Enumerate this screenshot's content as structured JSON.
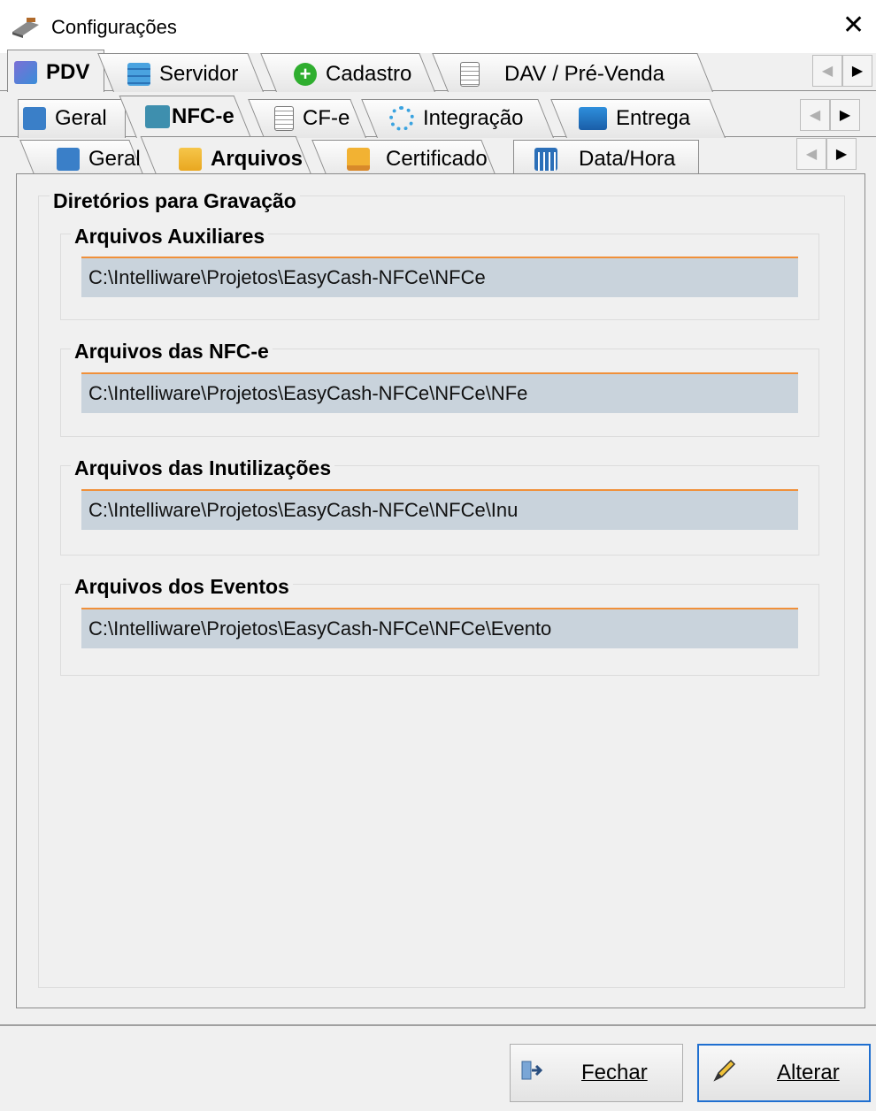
{
  "window": {
    "title": "Configurações"
  },
  "tabs_level1": [
    {
      "label": "PDV",
      "icon": "pdv-icon",
      "active": true
    },
    {
      "label": "Servidor",
      "icon": "server-icon"
    },
    {
      "label": "Cadastro",
      "icon": "add-icon"
    },
    {
      "label": "DAV / Pré-Venda",
      "icon": "document-icon"
    }
  ],
  "tabs_level2": [
    {
      "label": "Geral",
      "icon": "grid-icon"
    },
    {
      "label": "NFC-e",
      "icon": "nfce-icon",
      "active": true
    },
    {
      "label": "CF-e",
      "icon": "document-icon"
    },
    {
      "label": "Integração",
      "icon": "sync-icon"
    },
    {
      "label": "Entrega",
      "icon": "truck-icon"
    }
  ],
  "tabs_level3": [
    {
      "label": "Geral",
      "icon": "grid-icon"
    },
    {
      "label": "Arquivos",
      "icon": "folder-icon",
      "active": true
    },
    {
      "label": "Certificado",
      "icon": "certificate-icon"
    },
    {
      "label": "Data/Hora",
      "icon": "calendar-icon"
    }
  ],
  "main": {
    "section_title": "Diretórios para Gravação",
    "groups": [
      {
        "label": "Arquivos Auxiliares",
        "value": "C:\\Intelliware\\Projetos\\EasyCash-NFCe\\NFCe"
      },
      {
        "label": "Arquivos das NFC-e",
        "value": "C:\\Intelliware\\Projetos\\EasyCash-NFCe\\NFCe\\NFe"
      },
      {
        "label": "Arquivos das Inutilizações",
        "value": "C:\\Intelliware\\Projetos\\EasyCash-NFCe\\NFCe\\Inu"
      },
      {
        "label": "Arquivos dos Eventos",
        "value": "C:\\Intelliware\\Projetos\\EasyCash-NFCe\\NFCe\\Evento"
      }
    ]
  },
  "buttons": {
    "close": "Fechar",
    "edit": "Alterar"
  },
  "colors": {
    "field_bg": "#c9d3dc",
    "field_accent": "#f0903a",
    "default_button_border": "#1f6fd0"
  }
}
